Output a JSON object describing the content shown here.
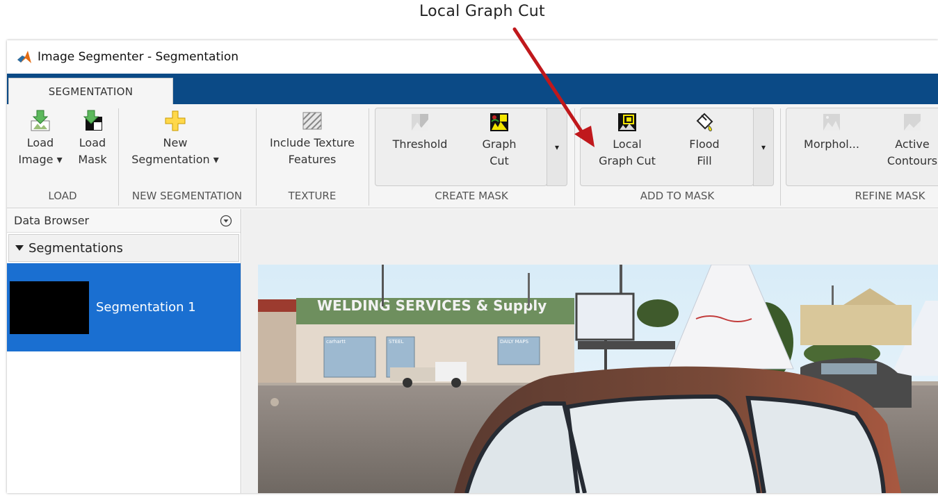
{
  "annotation": {
    "callout": "Local Graph Cut"
  },
  "window": {
    "title": "Image Segmenter - Segmentation"
  },
  "tabs": [
    {
      "label": "SEGMENTATION",
      "active": true
    }
  ],
  "toolstrip": {
    "load": {
      "group_label": "LOAD",
      "load_image_line1": "Load",
      "load_image_line2": "Image ▾",
      "load_mask_line1": "Load",
      "load_mask_line2": "Mask"
    },
    "new_segmentation": {
      "group_label": "NEW SEGMENTATION",
      "line1": "New",
      "line2": "Segmentation ▾"
    },
    "texture": {
      "group_label": "TEXTURE",
      "line1": "Include Texture",
      "line2": "Features"
    },
    "create_mask": {
      "group_label": "CREATE MASK",
      "threshold": "Threshold",
      "graph_cut_line1": "Graph",
      "graph_cut_line2": "Cut",
      "more": "▾"
    },
    "add_to_mask": {
      "group_label": "ADD TO MASK",
      "local_graph_cut_line1": "Local",
      "local_graph_cut_line2": "Graph Cut",
      "flood_fill_line1": "Flood",
      "flood_fill_line2": "Fill",
      "more": "▾"
    },
    "refine_mask": {
      "group_label": "REFINE MASK",
      "morphology": "Morphol...",
      "active_contours_line1": "Active",
      "active_contours_line2": "Contours"
    }
  },
  "data_browser": {
    "title": "Data Browser",
    "menu_icon": "chevron-circle-icon",
    "section": "Segmentations",
    "items": [
      {
        "label": "Segmentation 1",
        "selected": true
      }
    ]
  },
  "photo": {
    "sign_text": "WELDING SERVICES & Supply",
    "store_sign_1": "carhartt",
    "store_sign_2": "STEEL",
    "store_sign_3": "DAILY MAPS"
  },
  "colors": {
    "accent": "#0b4a86",
    "selection": "#1a6fd1",
    "arrow": "#c0181c"
  }
}
